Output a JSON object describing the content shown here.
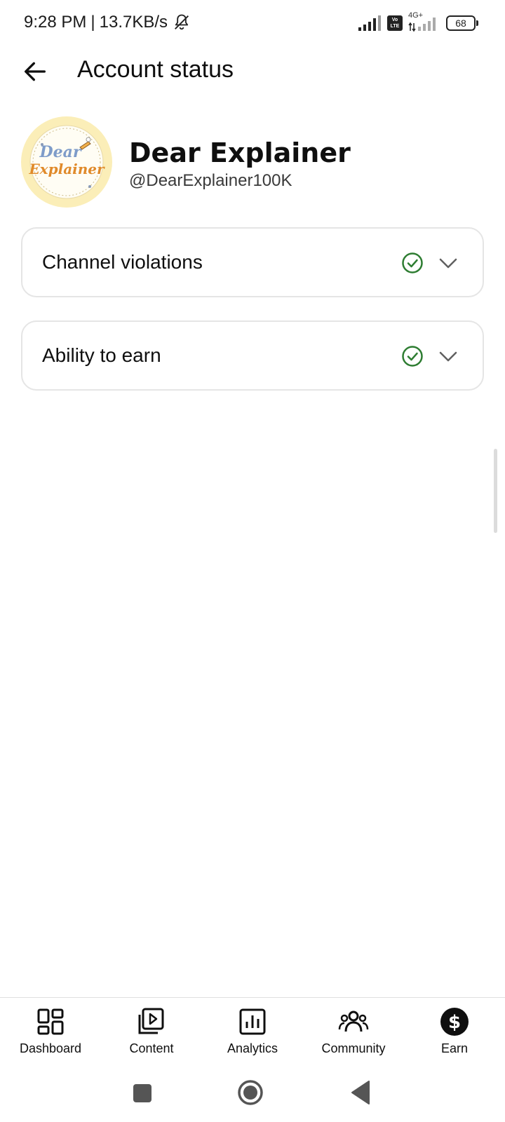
{
  "status_bar": {
    "time": "9:28 PM",
    "separator": "|",
    "speed": "13.7KB/s",
    "volte": "Vo LTE",
    "network": "4G+",
    "battery": "68"
  },
  "header": {
    "title": "Account status"
  },
  "channel": {
    "name": "Dear Explainer",
    "handle": "@DearExplainer100K",
    "avatar_line1": "Dear",
    "avatar_line2": "Explainer"
  },
  "cards": [
    {
      "label": "Channel violations",
      "status": "ok"
    },
    {
      "label": "Ability to earn",
      "status": "ok"
    }
  ],
  "bottom_nav": {
    "items": [
      {
        "label": "Dashboard",
        "icon": "dashboard-icon"
      },
      {
        "label": "Content",
        "icon": "content-icon"
      },
      {
        "label": "Analytics",
        "icon": "analytics-icon"
      },
      {
        "label": "Community",
        "icon": "community-icon"
      },
      {
        "label": "Earn",
        "icon": "earn-icon",
        "selected": true
      }
    ]
  },
  "colors": {
    "check_green": "#2e7d32",
    "text_primary": "#0f0f0f",
    "border": "#e5e5e5",
    "avatar_bg": "#fbeeb8"
  }
}
